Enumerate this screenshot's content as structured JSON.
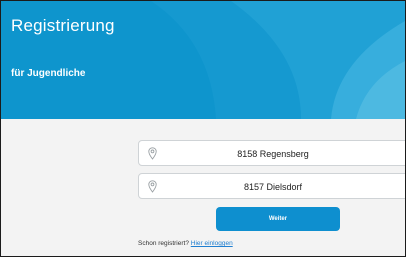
{
  "hero": {
    "title": "Registrierung",
    "subtitle": "für Jugendliche"
  },
  "fields": [
    {
      "icon": "location-pin-icon",
      "value": "8158 Regensberg"
    },
    {
      "icon": "location-pin-icon",
      "value": "8157 Dielsdorf"
    }
  ],
  "actions": {
    "continue_label": "Weiter"
  },
  "login": {
    "prompt": "Schon registriert?",
    "link": "Hier einloggen"
  },
  "colors": {
    "brand_blue": "#0e95cd",
    "button_blue": "#0e8fcf",
    "page_background": "#f3f3f3",
    "link": "#1f7fd1"
  }
}
